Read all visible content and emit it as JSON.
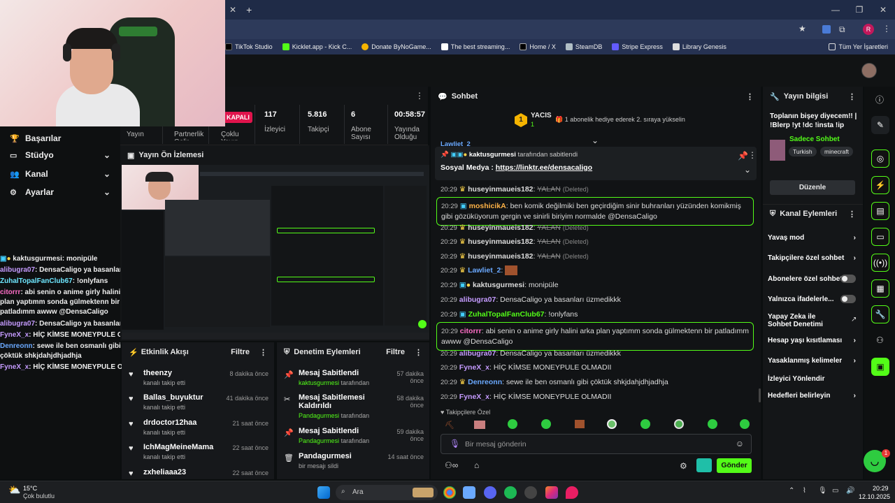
{
  "browser": {
    "bookmarks": [
      "TikTok Studio",
      "Kicklet.app - Kick C...",
      "Donate ByNoGame...",
      "The best streaming...",
      "Home / X",
      "SteamDB",
      "Stripe Express",
      "Library Genesis"
    ],
    "all_bookmarks": "Tüm Yer İşaretleri",
    "profile_initial": "R"
  },
  "leftnav": {
    "items": [
      {
        "label": "Başarılar"
      },
      {
        "label": "Stüdyo"
      },
      {
        "label": "Kanal"
      },
      {
        "label": "Ayarlar"
      }
    ]
  },
  "overlay_chat": [
    {
      "user": "kaktusgurmesi",
      "text": ": monipüle",
      "color": "#ffffff"
    },
    {
      "user": "alibugra07",
      "text": ": DensaCaligo ya basanları üzmedikkk",
      "color": "#c59bff"
    },
    {
      "user": "ZuhalTopalFanClub67",
      "text": ": !onlyfans",
      "color": "#6ee7ff"
    },
    {
      "user": "citorrr",
      "text": ": abi senin o anime girly halini arka plan yaptımm sonda gülmektenn bir patladımm awww @DensaCaligo",
      "color": "#ff6ec7"
    },
    {
      "user": "alibugra07",
      "text": ": DensaCaligo ya basanları üzmedikkk",
      "color": "#c59bff"
    },
    {
      "user": "FyneX_x",
      "text": ": HİÇ KİMSE MONEYPULE OLMADII",
      "color": "#c59bff"
    },
    {
      "user": "Denreonn",
      "text": ": sewe ile ben osmanlı gibi çöktük shkjdahjdhjadhja",
      "color": "#6aa9ff"
    },
    {
      "user": "FyneX_x",
      "text": ": HİÇ KİMSE MONEYPULE OLMADII",
      "color": "#c59bff"
    }
  ],
  "stream_stats": {
    "status_badge": "KAPALI",
    "stats": [
      {
        "value": "117",
        "label": "İzleyici"
      },
      {
        "value": "5.816",
        "label": "Takipçi"
      },
      {
        "value": "6",
        "label": "Abone Sayısı"
      },
      {
        "value": "00:58:57",
        "label": "Yayında Olduğu"
      }
    ],
    "sub_labels": [
      "Yayın",
      "Partnerlik Gelir",
      "Çoklu Yayın"
    ]
  },
  "preview": {
    "title": "Yayın Ön İzlemesi"
  },
  "activity": {
    "title": "Etkinlik Akışı",
    "filter": "Filtre",
    "items": [
      {
        "name": "theenzy",
        "sub": "kanalı takip etti",
        "time": "8 dakika önce"
      },
      {
        "name": "Ballas_buyuktur",
        "sub": "kanalı takip etti",
        "time": "41 dakika önce"
      },
      {
        "name": "drdoctor12haa",
        "sub": "kanalı takip etti",
        "time": "21 saat önce"
      },
      {
        "name": "IchMagMeineMama",
        "sub": "kanalı takip etti",
        "time": "22 saat önce"
      },
      {
        "name": "zxheliaaa23",
        "sub": "",
        "time": "22 saat önce"
      }
    ]
  },
  "moderation": {
    "title": "Denetim Eylemleri",
    "filter": "Filtre",
    "items": [
      {
        "name": "Mesaj Sabitlendi",
        "user": "kaktusgurmesi",
        "suffix": "tarafından",
        "time": "57 dakika önce",
        "icon": "📌"
      },
      {
        "name": "Mesaj Sabitlemesi Kaldırıldı",
        "user": "Pandagurmesi",
        "suffix": "tarafından",
        "time": "58 dakika önce",
        "icon": "✂"
      },
      {
        "name": "Mesaj Sabitlendi",
        "user": "Pandagurmesi",
        "suffix": "tarafından",
        "time": "59 dakika önce",
        "icon": "📌"
      },
      {
        "name": "Pandagurmesi",
        "user": "",
        "suffix": "bir mesajı sildi",
        "time": "14 saat önce",
        "icon": "🗑"
      }
    ]
  },
  "chat": {
    "title": "Sohbet",
    "leader_name": "YACIS",
    "leader_rank": "1",
    "leader_count": "1",
    "leader_text": "1 abonelik hediye ederek 2. sıraya yükselin",
    "pinned_by": "kaktusgurmesi",
    "pinned_suffix": "tarafından sabitlendi",
    "pinned_text": "Sosyal Medya : ",
    "pinned_link": "https://linktr.ee/densacaligo",
    "messages": [
      {
        "time": "20:29",
        "user": "huseyinmaueis182",
        "text": "YALAN",
        "deleted": "(Deleted)",
        "color": "#ffffff",
        "strike": true
      },
      {
        "time": "20:29",
        "user": "moshicikA",
        "text": "ben komik değilmiki ben geçirdiğim sinir buhranları yüzünden komikmiş gibi gözüküyorum gergin ve sinirli biriyim normalde @DensaCaligo",
        "color": "#ffb347",
        "highlight": true
      },
      {
        "time": "20:29",
        "user": "huseyinmaueis182",
        "text": "YALAN",
        "deleted": "(Deleted)",
        "color": "#ffffff",
        "strike": true
      },
      {
        "time": "20:29",
        "user": "huseyinmaueis182",
        "text": "YALAN",
        "deleted": "(Deleted)",
        "color": "#ffffff",
        "strike": true
      },
      {
        "time": "20:29",
        "user": "huseyinmaueis182",
        "text": "YALAN",
        "deleted": "(Deleted)",
        "color": "#ffffff",
        "strike": true
      },
      {
        "time": "20:29",
        "user": "Lawliet_2",
        "text": "",
        "color": "#6aa9ff"
      },
      {
        "time": "20:29",
        "user": "kaktusgurmesi",
        "text": "monipüle",
        "color": "#ffffff"
      },
      {
        "time": "20:29",
        "user": "alibugra07",
        "text": "DensaCaligo ya basanları üzmedikkk",
        "color": "#c59bff"
      },
      {
        "time": "20:29",
        "user": "ZuhalTopalFanClub67",
        "text": "!onlyfans",
        "color": "#53fc18"
      },
      {
        "time": "20:29",
        "user": "citorrr",
        "text": "abi senin o anime girly halini arka plan yaptımm sonda gülmektenn bir patladımm awww @DensaCaligo",
        "color": "#ff6ec7",
        "highlight": true
      },
      {
        "time": "20:29",
        "user": "alibugra07",
        "text": "DensaCaligo ya basanları üzmedikkk",
        "color": "#c59bff"
      },
      {
        "time": "20:29",
        "user": "FyneX_x",
        "text": "HİÇ KİMSE MONEYPULE OLMADII",
        "color": "#c59bff"
      },
      {
        "time": "20:29",
        "user": "Denreonn",
        "text": "sewe ile ben osmanlı gibi çöktük shkjdahjdhjadhja",
        "color": "#6aa9ff"
      },
      {
        "time": "20:29",
        "user": "FyneX_x",
        "text": "HİÇ KİMSE MONEYPULE OLMADII",
        "color": "#c59bff"
      }
    ],
    "emote_label": "Takipçilere Özel",
    "input_placeholder": "Bir mesaj gönderin",
    "send_label": "Gönder"
  },
  "stream_info": {
    "title": "Yayın bilgisi",
    "stream_title": "Toplanın bişey diyecem!! | !Blerp !yt !dc !insta !ip",
    "category": "Sadece Sohbet",
    "tags": [
      "Turkish",
      "minecraft"
    ],
    "edit_label": "Düzenle"
  },
  "channel_actions": {
    "title": "Kanal Eylemleri",
    "items": [
      {
        "label": "Yavaş mod",
        "type": "arrow"
      },
      {
        "label": "Takipçilere özel sohbet",
        "type": "arrow"
      },
      {
        "label": "Abonelere özel sohbet",
        "type": "toggle"
      },
      {
        "label": "Yalnızca ifadelerle...",
        "type": "toggle"
      },
      {
        "label": "Yapay Zeka ile Sohbet Denetimi",
        "type": "ext"
      },
      {
        "label": "Hesap yaşı kısıtlaması",
        "type": "arrow"
      },
      {
        "label": "Yasaklanmış kelimeler",
        "type": "arrow"
      },
      {
        "label": "İzleyici Yönlendir",
        "type": "none"
      },
      {
        "label": "Hedefleri belirleyin",
        "type": "arrow"
      }
    ]
  },
  "taskbar": {
    "weather_temp": "15°C",
    "weather_desc": "Çok bulutlu",
    "search": "Ara",
    "time": "20:29",
    "date": "12.10.2025",
    "notif_count": "1"
  },
  "colors": {
    "accent": "#53fc18",
    "bg": "#0b0e0f",
    "panel": "#16181b"
  }
}
